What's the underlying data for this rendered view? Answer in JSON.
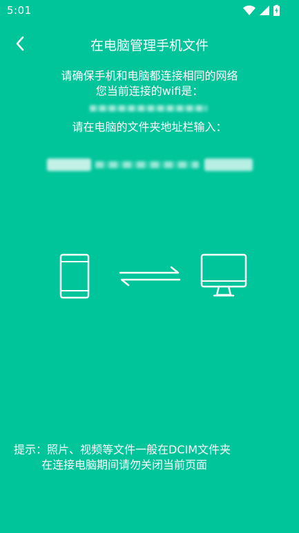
{
  "status_bar": {
    "time": "5:01",
    "icons": [
      "wifi-icon",
      "cell-signal-icon",
      "battery-charging-icon"
    ]
  },
  "header": {
    "back_icon": "chevron-left-icon",
    "title": "在电脑管理手机文件"
  },
  "connection": {
    "line1": "请确保手机和电脑都连接相同的网络",
    "line2": "您当前连接的wifi是：",
    "line3": "请在电脑的文件夹地址栏输入："
  },
  "illustration": {
    "left_icon": "phone-icon",
    "middle_icon": "transfer-arrows-icon",
    "right_icon": "monitor-icon"
  },
  "tips": {
    "line1": "提示：照片、视频等文件一般在DCIM文件夹",
    "line2": "在连接电脑期间请勿关闭当前页面"
  },
  "colors": {
    "background": "#00c49a",
    "foreground": "#ffffff"
  }
}
